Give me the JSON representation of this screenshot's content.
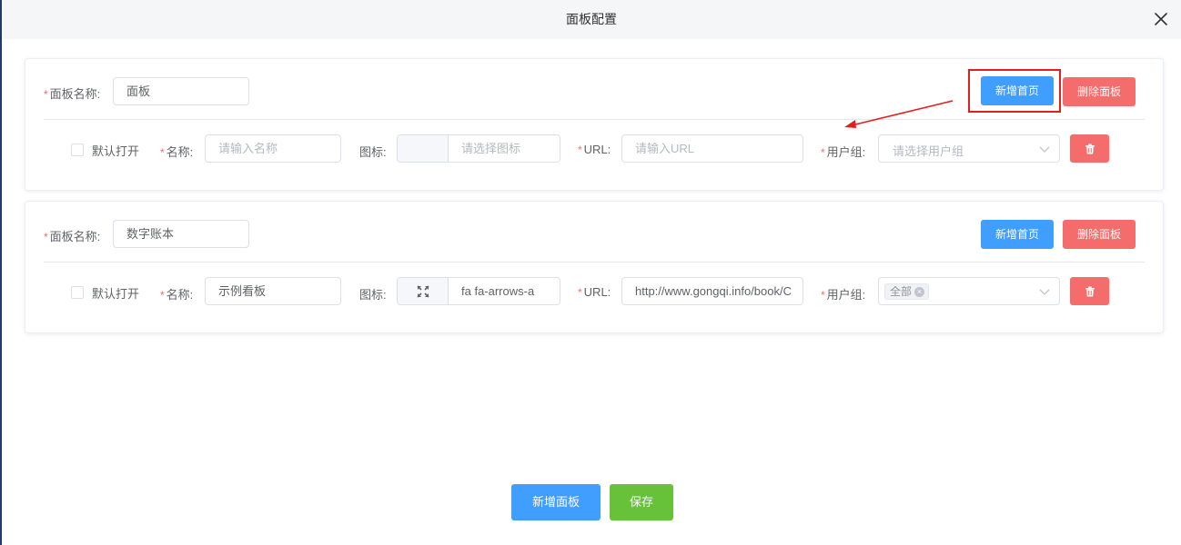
{
  "dialog": {
    "title": "面板配置"
  },
  "panels": [
    {
      "name_label": "面板名称:",
      "name_value": "面板",
      "add_home_label": "新增首页",
      "delete_panel_label": "删除面板",
      "row": {
        "default_open_label": "默认打开",
        "name_label": "名称:",
        "name_placeholder": "请输入名称",
        "icon_label": "图标:",
        "icon_placeholder": "请选择图标",
        "url_label": "URL:",
        "url_placeholder": "请输入URL",
        "group_label": "用户组:",
        "group_placeholder": "请选择用户组"
      }
    },
    {
      "name_label": "面板名称:",
      "name_value": "数字账本",
      "add_home_label": "新增首页",
      "delete_panel_label": "删除面板",
      "row": {
        "default_open_label": "默认打开",
        "name_label": "名称:",
        "name_value": "示例看板",
        "icon_label": "图标:",
        "icon_value": "fa fa-arrows-a",
        "icon_name": "arrows-alt-icon",
        "url_label": "URL:",
        "url_value": "http://www.gongqi.info/book/C",
        "group_label": "用户组:",
        "group_tag": "全部"
      }
    }
  ],
  "footer": {
    "add_panel_label": "新增面板",
    "save_label": "保存"
  },
  "colors": {
    "primary": "#409eff",
    "danger": "#f56c6c",
    "success": "#67c23a",
    "annotation": "#e02020"
  }
}
